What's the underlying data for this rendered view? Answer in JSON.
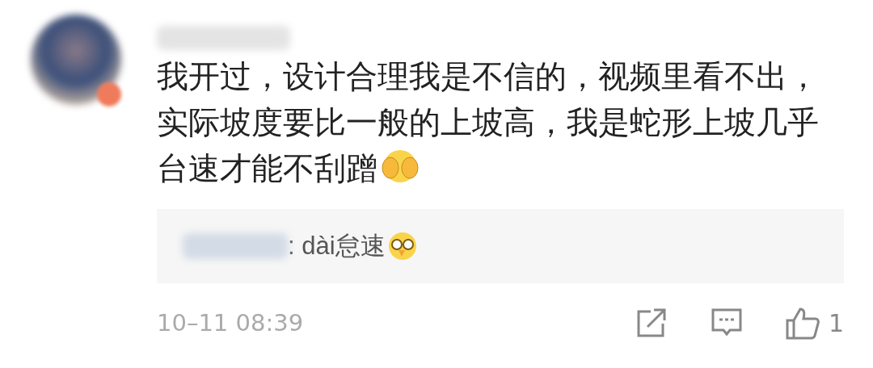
{
  "comment": {
    "text": "我开过，设计合理我是不信的，视频里看不出，实际坡度要比一般的上坡高，我是蛇形上坡几乎台速才能不刮蹭",
    "reply": {
      "text": ": dài怠速"
    },
    "time": "10–11 08:39",
    "like_count": "1"
  }
}
